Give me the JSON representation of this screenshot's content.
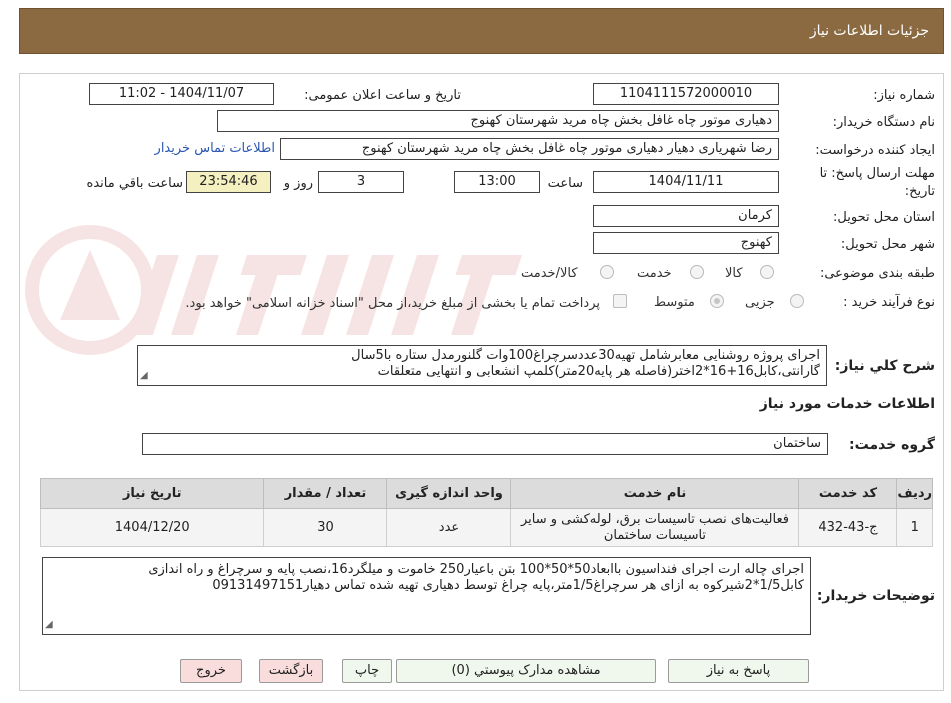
{
  "header": {
    "title": "جزئیات اطلاعات نیاز"
  },
  "fields": {
    "need_number_label": "شماره نیاز:",
    "need_number": "1104111572000010",
    "announce_label": "تاریخ و ساعت اعلان عمومی:",
    "announce_value": "1404/11/07 - 11:02",
    "buyer_org_label": "نام دستگاه خریدار:",
    "buyer_org": "دهیاری موتور چاه غافل بخش چاه مرید شهرستان کهنوج",
    "requester_label": "ایجاد کننده درخواست:",
    "requester": "رضا شهریاری دهیار دهیاری موتور چاه غافل بخش چاه مرید شهرستان کهنوج",
    "contact_link": "اطلاعات تماس خریدار",
    "deadline_label_1": "مهلت ارسال پاسخ: تا",
    "deadline_label_2": "تاریخ:",
    "deadline_date": "1404/11/11",
    "hour_label": "ساعت",
    "deadline_time": "13:00",
    "days": "3",
    "days_label": "روز و",
    "remaining_time": "23:54:46",
    "remaining_label": "ساعت باقي مانده",
    "province_label": "استان محل تحویل:",
    "province": "کرمان",
    "city_label": "شهر محل تحویل:",
    "city": "کهنوج",
    "category_label": "طبقه بندی موضوعی:",
    "category_options": [
      "کالا",
      "خدمت",
      "کالا/خدمت"
    ],
    "process_label": "نوع فرآیند خرید :",
    "process_options": [
      "جزیی",
      "متوسط"
    ],
    "payment_note": "پرداخت تمام یا بخشی از مبلغ خرید،از محل \"اسناد خزانه اسلامی\" خواهد بود."
  },
  "description": {
    "label": "شرح کلي نياز:",
    "line1": "اجرای پروژه روشنایی معابرشامل تهیه30عددسرچراغ100وات گلنورمدل ستاره با5سال",
    "line2": "گارانتی،کابل16+16*2اختر(فاصله هر پایه20متر)کلمپ انشعابی و انتهایی متعلقات"
  },
  "services": {
    "section_title": "اطلاعات خدمات مورد نیاز",
    "group_label": "گروه خدمت:",
    "group_value": "ساختمان",
    "columns": [
      "ردیف",
      "کد خدمت",
      "نام خدمت",
      "واحد اندازه گیری",
      "تعداد / مقدار",
      "تاریخ نیاز"
    ],
    "rows": [
      {
        "index": "1",
        "code": "ج-43-432",
        "name": "فعالیت‌های نصب تاسیسات برق، لوله‌کشی و سایر تاسیسات ساختمان",
        "unit": "عدد",
        "qty": "30",
        "date": "1404/12/20"
      }
    ]
  },
  "buyer_notes": {
    "label": "توضیحات خریدار:",
    "line1": "اجرای چاله ارت اجرای فنداسیون باابعاد50*50*100 بتن باعیار250 خاموت و میلگرد16،نصب پایه و سرچراغ و راه اندازی",
    "line2": "کابل1/5*2شیرکوه به ازای هر سرچراغ1/5متر،پایه چراغ توسط دهیاری تهیه شده تماس دهیار09131497151"
  },
  "buttons": {
    "reply": "پاسخ به نیاز",
    "attachments": "مشاهده مدارک پیوستي (0)",
    "print": "چاپ",
    "back": "بازگشت",
    "exit": "خروج"
  }
}
